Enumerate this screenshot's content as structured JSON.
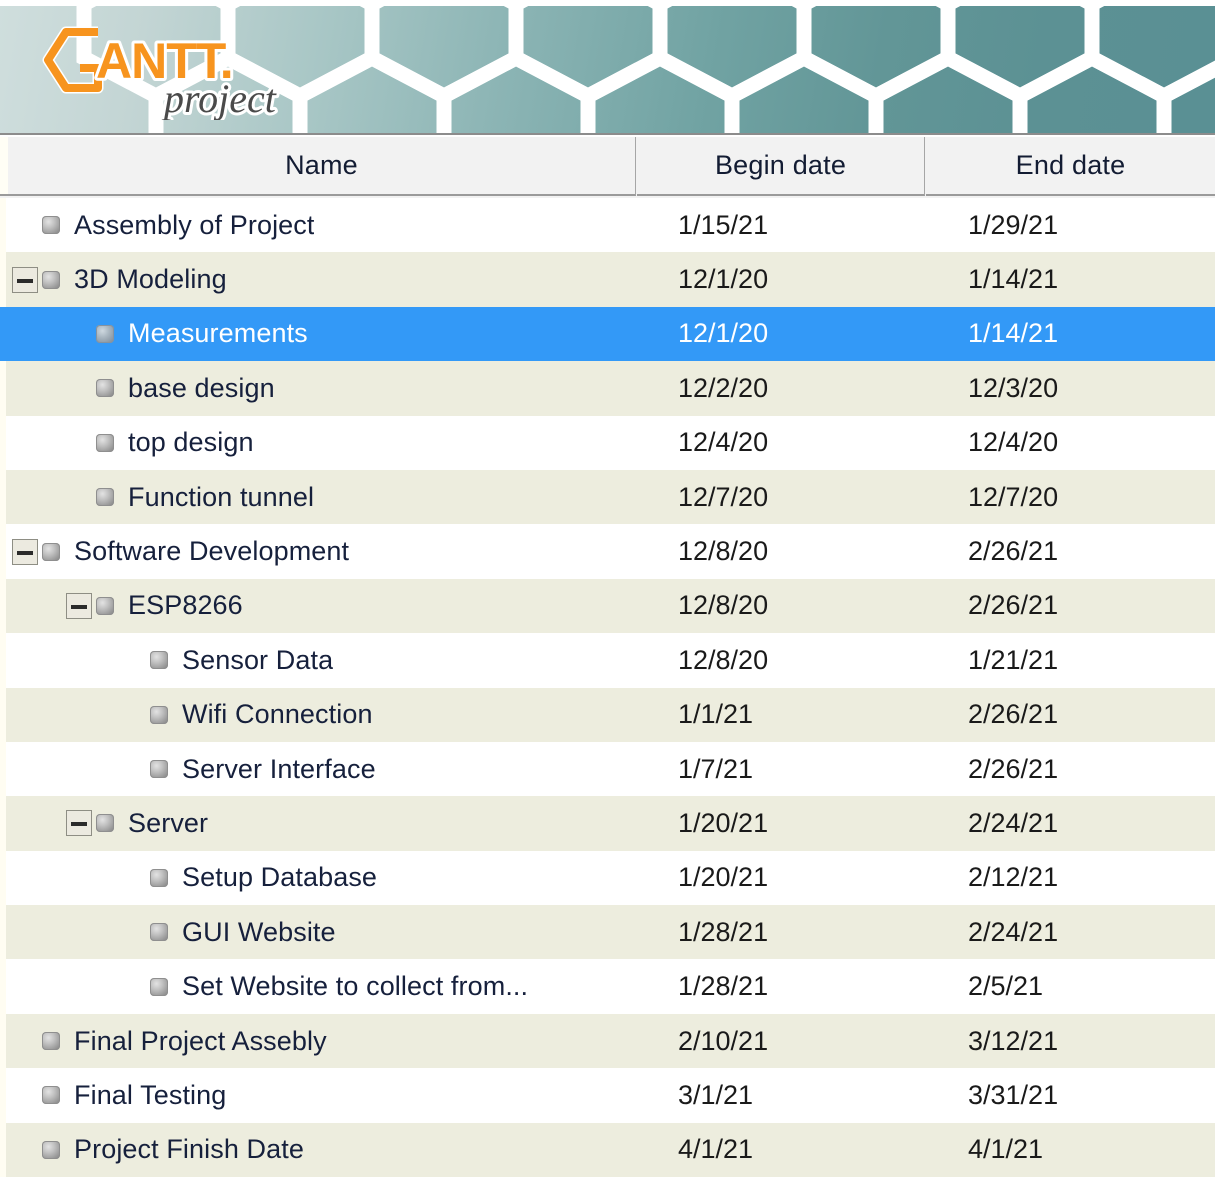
{
  "app": {
    "name": "GanttProject",
    "logo_primary": "GANTT",
    "logo_secondary": "project",
    "logo_color": "#F7941E",
    "banner_color_left": "#CFDEDD",
    "banner_color_right": "#5A9094"
  },
  "table": {
    "columns": [
      {
        "id": "name",
        "label": "Name"
      },
      {
        "id": "begin",
        "label": "Begin date"
      },
      {
        "id": "end",
        "label": "End date"
      }
    ],
    "selection_color": "#3399F7",
    "alt_row_color": "#EDEDDE",
    "rows": [
      {
        "name": "Assembly of Project",
        "begin": "1/15/21",
        "end": "1/29/21",
        "level": 0,
        "expander": "none",
        "shade": "white",
        "selected": false
      },
      {
        "name": "3D Modeling",
        "begin": "12/1/20",
        "end": "1/14/21",
        "level": 0,
        "expander": "collapse",
        "shade": "alt",
        "selected": false
      },
      {
        "name": "Measurements",
        "begin": "12/1/20",
        "end": "1/14/21",
        "level": 1,
        "expander": "none",
        "shade": "selected",
        "selected": true
      },
      {
        "name": "base design",
        "begin": "12/2/20",
        "end": "12/3/20",
        "level": 1,
        "expander": "none",
        "shade": "alt",
        "selected": false
      },
      {
        "name": "top design",
        "begin": "12/4/20",
        "end": "12/4/20",
        "level": 1,
        "expander": "none",
        "shade": "white",
        "selected": false
      },
      {
        "name": "Function tunnel",
        "begin": "12/7/20",
        "end": "12/7/20",
        "level": 1,
        "expander": "none",
        "shade": "alt",
        "selected": false
      },
      {
        "name": "Software Development",
        "begin": "12/8/20",
        "end": "2/26/21",
        "level": 0,
        "expander": "collapse",
        "shade": "white",
        "selected": false
      },
      {
        "name": "ESP8266",
        "begin": "12/8/20",
        "end": "2/26/21",
        "level": 1,
        "expander": "collapse",
        "shade": "alt",
        "selected": false
      },
      {
        "name": "Sensor Data",
        "begin": "12/8/20",
        "end": "1/21/21",
        "level": 2,
        "expander": "none",
        "shade": "white",
        "selected": false
      },
      {
        "name": "Wifi Connection",
        "begin": "1/1/21",
        "end": "2/26/21",
        "level": 2,
        "expander": "none",
        "shade": "alt",
        "selected": false
      },
      {
        "name": "Server Interface",
        "begin": "1/7/21",
        "end": "2/26/21",
        "level": 2,
        "expander": "none",
        "shade": "white",
        "selected": false
      },
      {
        "name": "Server",
        "begin": "1/20/21",
        "end": "2/24/21",
        "level": 1,
        "expander": "collapse",
        "shade": "alt",
        "selected": false
      },
      {
        "name": "Setup Database",
        "begin": "1/20/21",
        "end": "2/12/21",
        "level": 2,
        "expander": "none",
        "shade": "white",
        "selected": false
      },
      {
        "name": "GUI Website",
        "begin": "1/28/21",
        "end": "2/24/21",
        "level": 2,
        "expander": "none",
        "shade": "alt",
        "selected": false
      },
      {
        "name": "Set Website to collect from...",
        "begin": "1/28/21",
        "end": "2/5/21",
        "level": 2,
        "expander": "none",
        "shade": "white",
        "selected": false
      },
      {
        "name": "Final Project Assebly",
        "begin": "2/10/21",
        "end": "3/12/21",
        "level": 0,
        "expander": "none",
        "shade": "alt",
        "selected": false
      },
      {
        "name": "Final Testing",
        "begin": "3/1/21",
        "end": "3/31/21",
        "level": 0,
        "expander": "none",
        "shade": "white",
        "selected": false
      },
      {
        "name": "Project Finish Date",
        "begin": "4/1/21",
        "end": "4/1/21",
        "level": 0,
        "expander": "none",
        "shade": "alt",
        "selected": false
      }
    ]
  }
}
